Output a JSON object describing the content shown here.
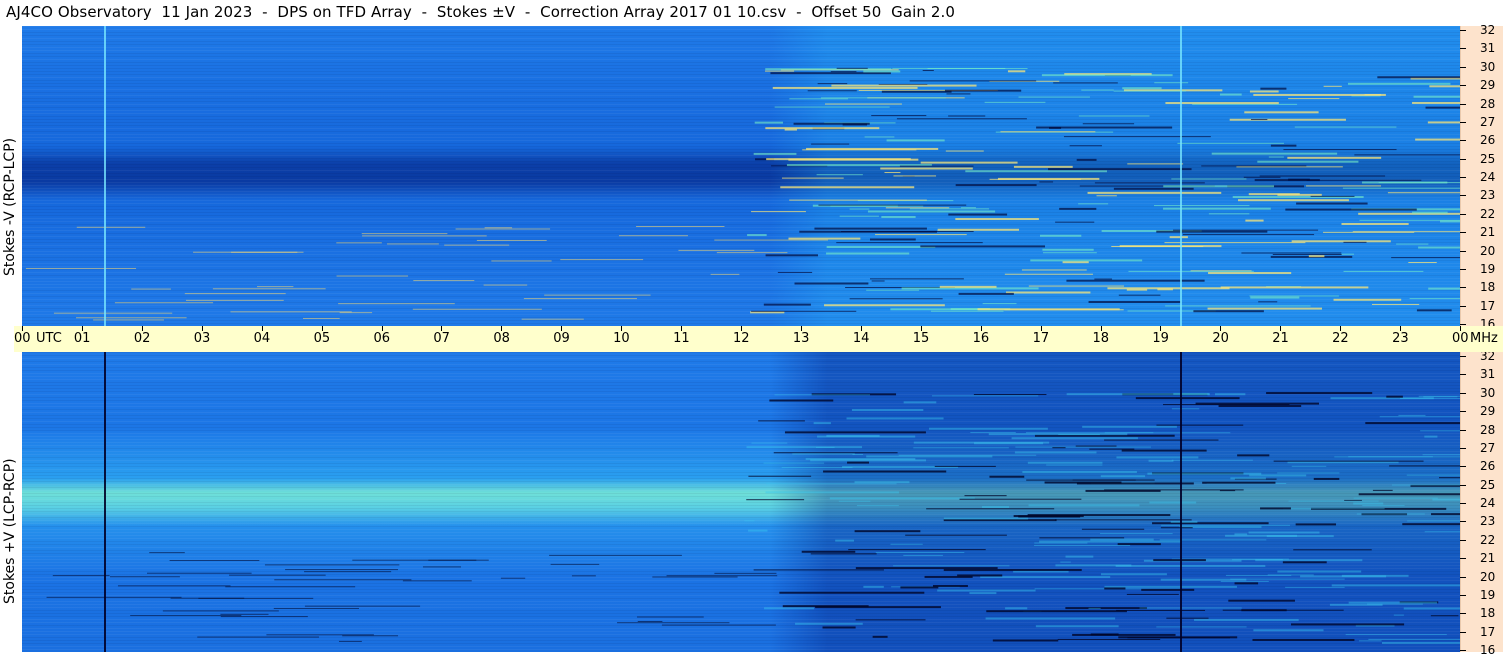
{
  "title": "AJ4CO Observatory  11 Jan 2023  -  DPS on TFD Array  -  Stokes ±V  -  Correction Array 2017 01 10.csv  -  Offset 50  Gain 2.0",
  "chart_data": {
    "type": "heatmap",
    "title": "AJ4CO Observatory  11 Jan 2023  -  DPS on TFD Array  -  Stokes ±V  -  Correction Array 2017 01 10.csv  -  Offset 50  Gain 2.0",
    "x_axis": {
      "unit": "UTC",
      "ticks": [
        "00",
        "01",
        "02",
        "03",
        "04",
        "05",
        "06",
        "07",
        "08",
        "09",
        "10",
        "11",
        "12",
        "13",
        "14",
        "15",
        "16",
        "17",
        "18",
        "19",
        "20",
        "21",
        "22",
        "23",
        "00"
      ],
      "range": [
        0,
        24
      ]
    },
    "y_axis": {
      "unit": "MHz",
      "ticks": [
        "16",
        "17",
        "18",
        "19",
        "20",
        "21",
        "22",
        "23",
        "24",
        "25",
        "26",
        "27",
        "28",
        "29",
        "30",
        "31",
        "32"
      ],
      "range": [
        16,
        32
      ]
    },
    "panels": [
      {
        "name": "top",
        "ylabel": "Stokes -V (RCP-LCP)"
      },
      {
        "name": "bottom",
        "ylabel": "Stokes +V (LCP-RCP)"
      }
    ],
    "colors": {
      "low": "#000a3a",
      "mid": "#1a6fe0",
      "high": "#f6e27a",
      "peak": "#ff4a1a"
    }
  }
}
